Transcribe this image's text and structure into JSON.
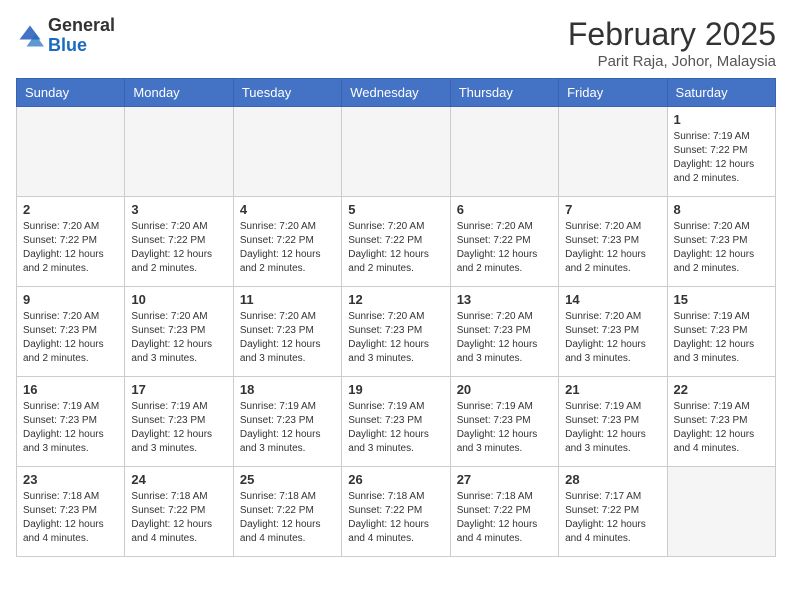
{
  "header": {
    "logo_general": "General",
    "logo_blue": "Blue",
    "title": "February 2025",
    "subtitle": "Parit Raja, Johor, Malaysia"
  },
  "weekdays": [
    "Sunday",
    "Monday",
    "Tuesday",
    "Wednesday",
    "Thursday",
    "Friday",
    "Saturday"
  ],
  "weeks": [
    [
      {
        "day": "",
        "info": ""
      },
      {
        "day": "",
        "info": ""
      },
      {
        "day": "",
        "info": ""
      },
      {
        "day": "",
        "info": ""
      },
      {
        "day": "",
        "info": ""
      },
      {
        "day": "",
        "info": ""
      },
      {
        "day": "1",
        "info": "Sunrise: 7:19 AM\nSunset: 7:22 PM\nDaylight: 12 hours\nand 2 minutes."
      }
    ],
    [
      {
        "day": "2",
        "info": "Sunrise: 7:20 AM\nSunset: 7:22 PM\nDaylight: 12 hours\nand 2 minutes."
      },
      {
        "day": "3",
        "info": "Sunrise: 7:20 AM\nSunset: 7:22 PM\nDaylight: 12 hours\nand 2 minutes."
      },
      {
        "day": "4",
        "info": "Sunrise: 7:20 AM\nSunset: 7:22 PM\nDaylight: 12 hours\nand 2 minutes."
      },
      {
        "day": "5",
        "info": "Sunrise: 7:20 AM\nSunset: 7:22 PM\nDaylight: 12 hours\nand 2 minutes."
      },
      {
        "day": "6",
        "info": "Sunrise: 7:20 AM\nSunset: 7:22 PM\nDaylight: 12 hours\nand 2 minutes."
      },
      {
        "day": "7",
        "info": "Sunrise: 7:20 AM\nSunset: 7:23 PM\nDaylight: 12 hours\nand 2 minutes."
      },
      {
        "day": "8",
        "info": "Sunrise: 7:20 AM\nSunset: 7:23 PM\nDaylight: 12 hours\nand 2 minutes."
      }
    ],
    [
      {
        "day": "9",
        "info": "Sunrise: 7:20 AM\nSunset: 7:23 PM\nDaylight: 12 hours\nand 2 minutes."
      },
      {
        "day": "10",
        "info": "Sunrise: 7:20 AM\nSunset: 7:23 PM\nDaylight: 12 hours\nand 3 minutes."
      },
      {
        "day": "11",
        "info": "Sunrise: 7:20 AM\nSunset: 7:23 PM\nDaylight: 12 hours\nand 3 minutes."
      },
      {
        "day": "12",
        "info": "Sunrise: 7:20 AM\nSunset: 7:23 PM\nDaylight: 12 hours\nand 3 minutes."
      },
      {
        "day": "13",
        "info": "Sunrise: 7:20 AM\nSunset: 7:23 PM\nDaylight: 12 hours\nand 3 minutes."
      },
      {
        "day": "14",
        "info": "Sunrise: 7:20 AM\nSunset: 7:23 PM\nDaylight: 12 hours\nand 3 minutes."
      },
      {
        "day": "15",
        "info": "Sunrise: 7:19 AM\nSunset: 7:23 PM\nDaylight: 12 hours\nand 3 minutes."
      }
    ],
    [
      {
        "day": "16",
        "info": "Sunrise: 7:19 AM\nSunset: 7:23 PM\nDaylight: 12 hours\nand 3 minutes."
      },
      {
        "day": "17",
        "info": "Sunrise: 7:19 AM\nSunset: 7:23 PM\nDaylight: 12 hours\nand 3 minutes."
      },
      {
        "day": "18",
        "info": "Sunrise: 7:19 AM\nSunset: 7:23 PM\nDaylight: 12 hours\nand 3 minutes."
      },
      {
        "day": "19",
        "info": "Sunrise: 7:19 AM\nSunset: 7:23 PM\nDaylight: 12 hours\nand 3 minutes."
      },
      {
        "day": "20",
        "info": "Sunrise: 7:19 AM\nSunset: 7:23 PM\nDaylight: 12 hours\nand 3 minutes."
      },
      {
        "day": "21",
        "info": "Sunrise: 7:19 AM\nSunset: 7:23 PM\nDaylight: 12 hours\nand 3 minutes."
      },
      {
        "day": "22",
        "info": "Sunrise: 7:19 AM\nSunset: 7:23 PM\nDaylight: 12 hours\nand 4 minutes."
      }
    ],
    [
      {
        "day": "23",
        "info": "Sunrise: 7:18 AM\nSunset: 7:23 PM\nDaylight: 12 hours\nand 4 minutes."
      },
      {
        "day": "24",
        "info": "Sunrise: 7:18 AM\nSunset: 7:22 PM\nDaylight: 12 hours\nand 4 minutes."
      },
      {
        "day": "25",
        "info": "Sunrise: 7:18 AM\nSunset: 7:22 PM\nDaylight: 12 hours\nand 4 minutes."
      },
      {
        "day": "26",
        "info": "Sunrise: 7:18 AM\nSunset: 7:22 PM\nDaylight: 12 hours\nand 4 minutes."
      },
      {
        "day": "27",
        "info": "Sunrise: 7:18 AM\nSunset: 7:22 PM\nDaylight: 12 hours\nand 4 minutes."
      },
      {
        "day": "28",
        "info": "Sunrise: 7:17 AM\nSunset: 7:22 PM\nDaylight: 12 hours\nand 4 minutes."
      },
      {
        "day": "",
        "info": ""
      }
    ]
  ]
}
